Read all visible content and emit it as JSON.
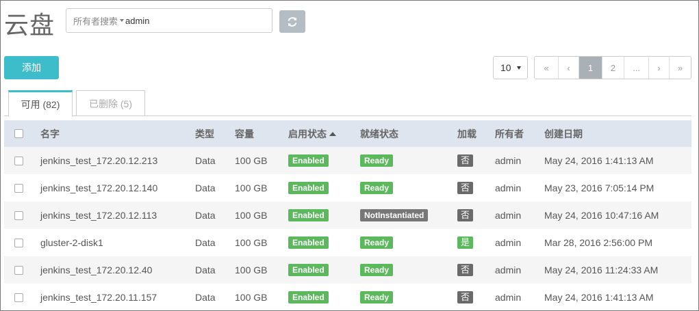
{
  "header": {
    "title": "云盘",
    "search": {
      "scope": "所有者搜索",
      "value": "admin"
    }
  },
  "toolbar": {
    "add_label": "添加",
    "page_size": "10",
    "pagination": [
      "«",
      "‹",
      "1",
      "2",
      "...",
      "›",
      "»"
    ],
    "active_page": "1"
  },
  "tabs": [
    {
      "label": "可用 (82)",
      "active": true
    },
    {
      "label": "已删除 (5)",
      "active": false
    }
  ],
  "table": {
    "columns": [
      "名字",
      "类型",
      "容量",
      "启用状态",
      "就绪状态",
      "加载",
      "所有者",
      "创建日期"
    ],
    "sorted_column": "启用状态",
    "rows": [
      {
        "name": "jenkins_test_172.20.12.213",
        "type": "Data",
        "size": "100 GB",
        "enabled": "Enabled",
        "ready": "Ready",
        "loaded": "否",
        "owner": "admin",
        "created": "May 24, 2016 1:41:13 AM"
      },
      {
        "name": "jenkins_test_172.20.12.140",
        "type": "Data",
        "size": "100 GB",
        "enabled": "Enabled",
        "ready": "Ready",
        "loaded": "否",
        "owner": "admin",
        "created": "May 23, 2016 7:05:14 PM"
      },
      {
        "name": "jenkins_test_172.20.12.113",
        "type": "Data",
        "size": "100 GB",
        "enabled": "Enabled",
        "ready": "NotInstantiated",
        "loaded": "否",
        "owner": "admin",
        "created": "May 24, 2016 10:47:16 AM"
      },
      {
        "name": "gluster-2-disk1",
        "type": "Data",
        "size": "100 GB",
        "enabled": "Enabled",
        "ready": "Ready",
        "loaded": "是",
        "owner": "admin",
        "created": "Mar 28, 2016 2:56:00 PM"
      },
      {
        "name": "jenkins_test_172.20.12.40",
        "type": "Data",
        "size": "100 GB",
        "enabled": "Enabled",
        "ready": "Ready",
        "loaded": "否",
        "owner": "admin",
        "created": "May 24, 2016 11:24:33 AM"
      },
      {
        "name": "jenkins_test_172.20.11.157",
        "type": "Data",
        "size": "100 GB",
        "enabled": "Enabled",
        "ready": "Ready",
        "loaded": "否",
        "owner": "admin",
        "created": "May 24, 2016 1:41:13 AM"
      }
    ]
  },
  "colors": {
    "accent": "#3dbdc9",
    "badge_green": "#5cb85c",
    "badge_gray": "#777777",
    "header_bg": "#dfe5ee"
  }
}
